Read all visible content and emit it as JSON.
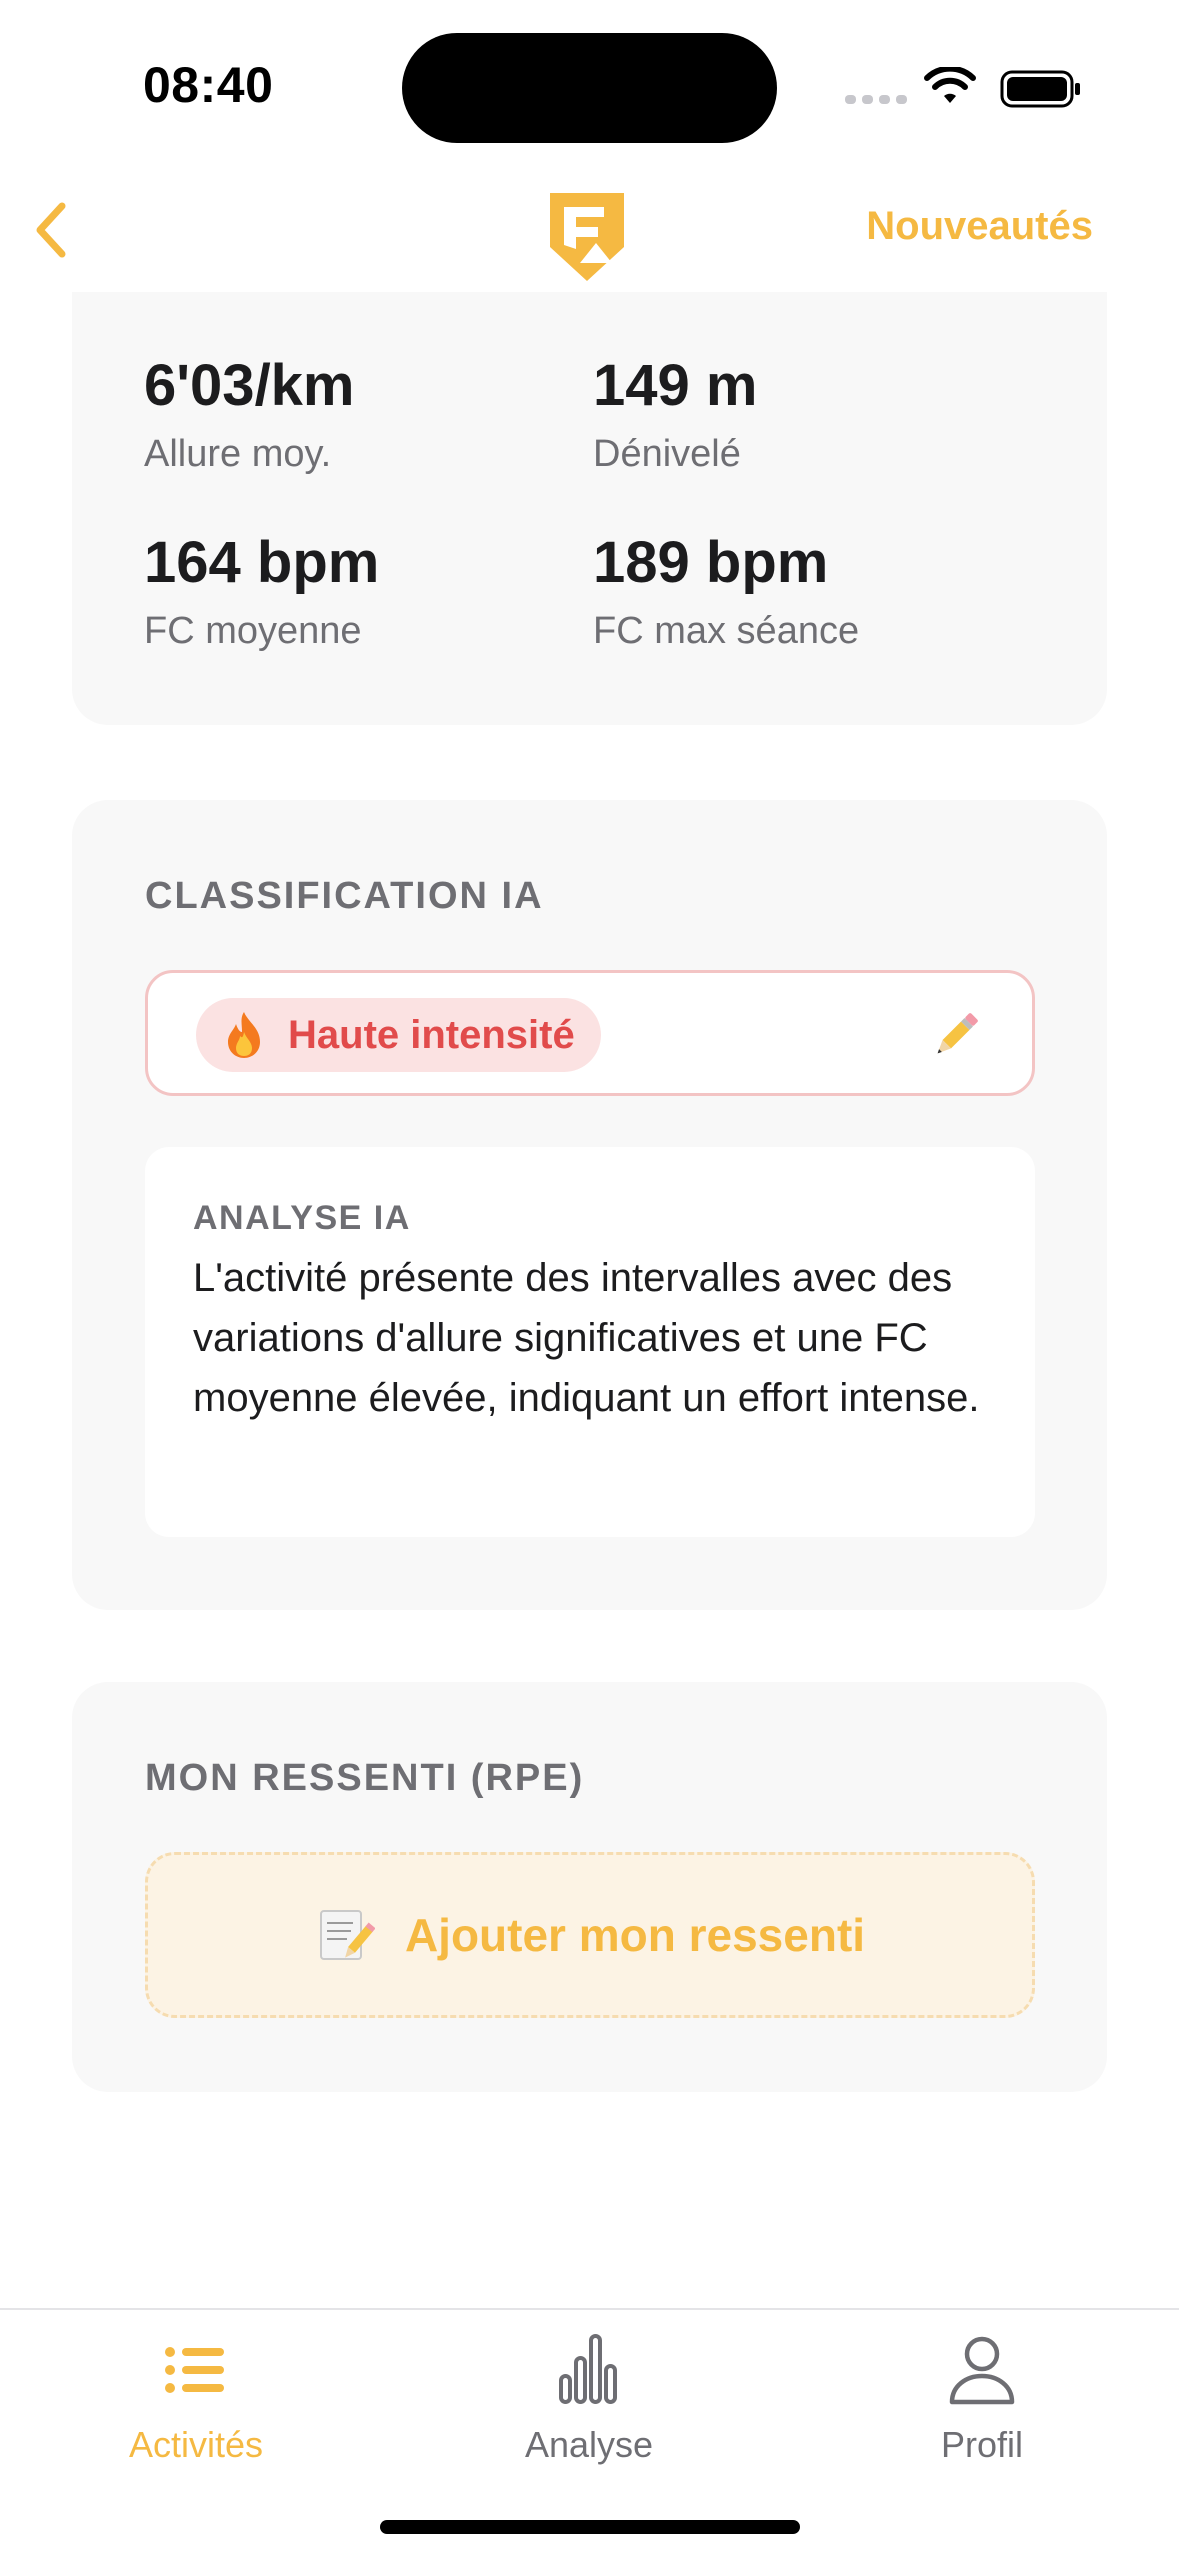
{
  "status_bar": {
    "time": "08:40"
  },
  "nav": {
    "back_icon": "chevron-left-icon",
    "logo_icon": "app-logo-icon",
    "news_label": "Nouveautés"
  },
  "stats": [
    {
      "value": "6'03/km",
      "label": "Allure moy."
    },
    {
      "value": "149 m",
      "label": "Dénivelé"
    },
    {
      "value": "164 bpm",
      "label": "FC moyenne"
    },
    {
      "value": "189 bpm",
      "label": "FC max séance"
    }
  ],
  "classification": {
    "title": "CLASSIFICATION IA",
    "badge_icon": "fire-icon",
    "badge_label": "Haute intensité",
    "edit_icon": "pencil-icon",
    "analysis_title": "ANALYSE IA",
    "analysis_text": "L'activité présente des intervalles avec des variations d'allure significatives et une FC moyenne élevée, indiquant un effort intense."
  },
  "rpe": {
    "title": "MON RESSENTI (RPE)",
    "button_icon": "memo-icon",
    "button_label": "Ajouter mon ressenti"
  },
  "tabs": [
    {
      "label": "Activités",
      "icon": "list-icon",
      "active": true
    },
    {
      "label": "Analyse",
      "icon": "bar-chart-icon",
      "active": false
    },
    {
      "label": "Profil",
      "icon": "person-icon",
      "active": false
    }
  ],
  "colors": {
    "accent": "#f5b942",
    "danger": "#e14b4b",
    "card_bg": "#f8f8f8"
  }
}
